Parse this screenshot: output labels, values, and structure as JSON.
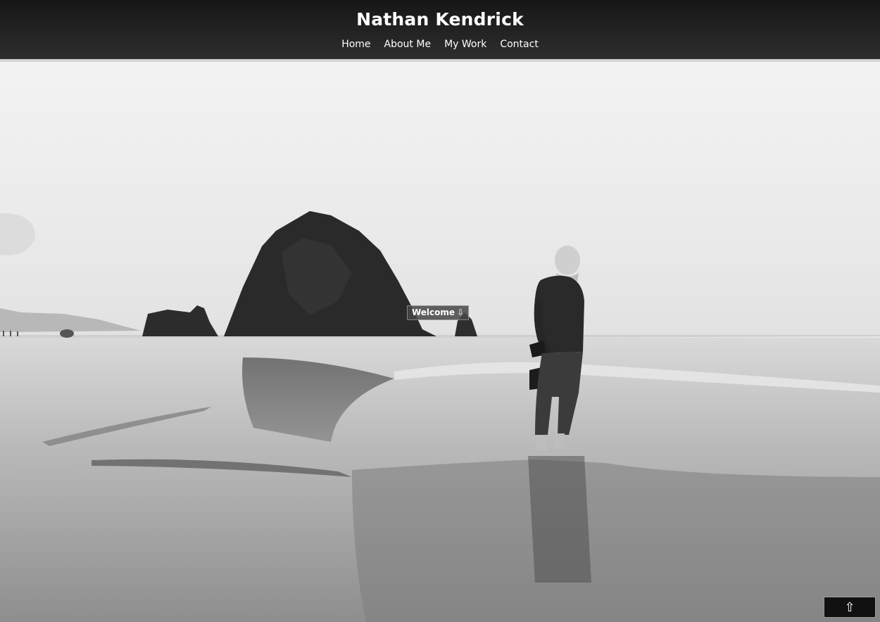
{
  "header": {
    "title": "Nathan Kendrick",
    "nav": [
      {
        "label": "Home"
      },
      {
        "label": "About Me"
      },
      {
        "label": "My Work"
      },
      {
        "label": "Contact"
      }
    ]
  },
  "hero": {
    "welcome_label": "Welcome",
    "welcome_icon": "down-arrow-icon"
  },
  "back_to_top": {
    "icon": "up-arrow-icon"
  },
  "colors": {
    "header_bg": "#1e1e1e",
    "header_text": "#ffffff",
    "button_bg": "#111111"
  }
}
